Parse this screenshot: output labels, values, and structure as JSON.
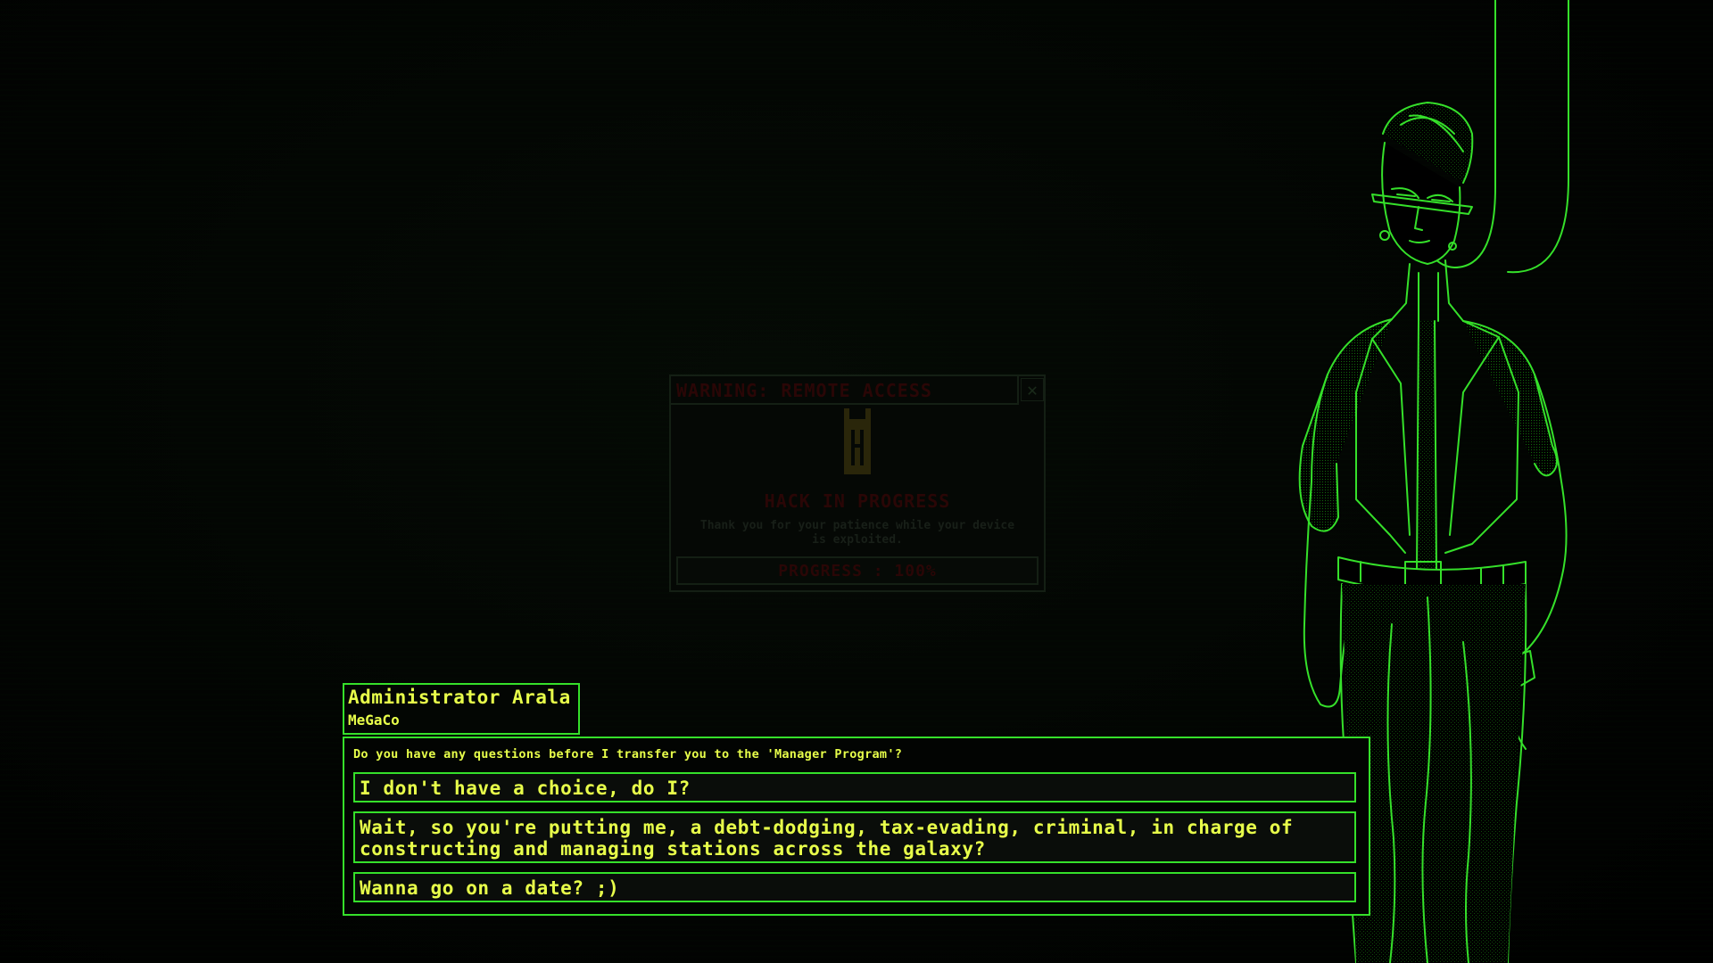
{
  "colors": {
    "accent_green": "#35e02a",
    "text_yellow": "#e8ff4a",
    "warning_red": "#2a0606",
    "background": "#000000"
  },
  "warning_popup": {
    "title": "WARNING: REMOTE ACCESS",
    "close_icon": "close-icon",
    "icon": "castle-tower-icon",
    "heading": "HACK IN PROGRESS",
    "message": "Thank you for your patience while your device is exploited.",
    "progress_label": "PROGRESS : 100%",
    "progress_value": 1.0
  },
  "speaker": {
    "name": "Administrator Arala",
    "organization": "MeGaCo"
  },
  "dialogue": {
    "prompt": "Do you have any questions before I transfer you to the 'Manager Program'?",
    "choices": [
      {
        "label": "I don't have a choice, do I?"
      },
      {
        "label": "Wait, so you're putting me, a debt-dodging, tax-evading, criminal, in charge of\nconstructing and managing stations across the galaxy?"
      },
      {
        "label": "Wanna go on a date? ;)"
      }
    ]
  }
}
